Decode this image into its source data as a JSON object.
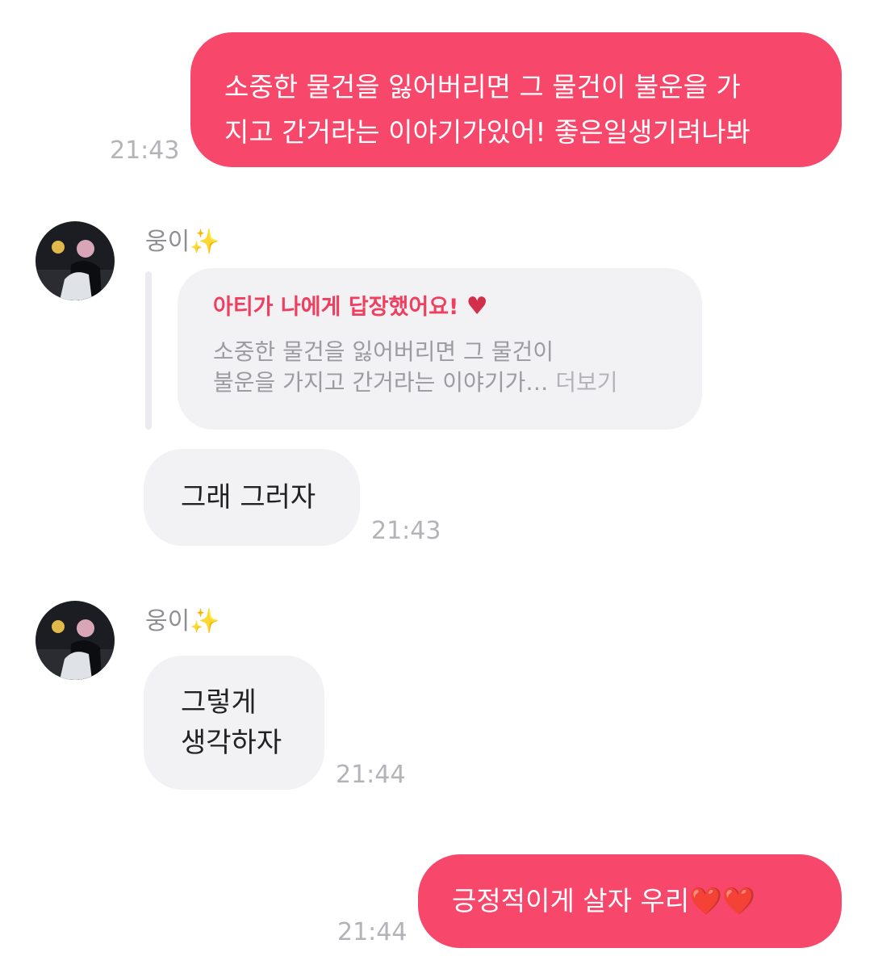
{
  "messages": {
    "m1": {
      "lines": [
        "소중한 물건을 잃어버리면 그 물건이 불운을 가",
        "지고 간거라는 이야기가있어! 좋은일생기려나봐"
      ],
      "time": "21:43"
    },
    "m2": {
      "sender": "웅이",
      "sparkle": "✨",
      "reply": {
        "title": "아티가 나에게 답장했어요!",
        "heart": "♥",
        "lines": [
          "소중한 물건을 잃어버리면 그 물건이",
          "불운을 가지고 간거라는 이야기가…"
        ],
        "more": "더보기"
      },
      "text": "그래 그러자",
      "time": "21:43"
    },
    "m3": {
      "sender": "웅이",
      "sparkle": "✨",
      "lines": [
        "그렇게",
        "생각하자"
      ],
      "time": "21:44"
    },
    "m4": {
      "text": "긍정적이게 살자 우리",
      "emoji": "❤️❤️",
      "time": "21:44"
    }
  },
  "colors": {
    "outgoing_bubble": "#f7476a",
    "incoming_bubble": "#f2f2f5",
    "reply_title": "#f03e5f",
    "timestamp": "#b3b3b8"
  },
  "icons": {
    "avatar": "profile-photo",
    "sparkle": "sparkles-emoji",
    "heart": "red-heart"
  }
}
